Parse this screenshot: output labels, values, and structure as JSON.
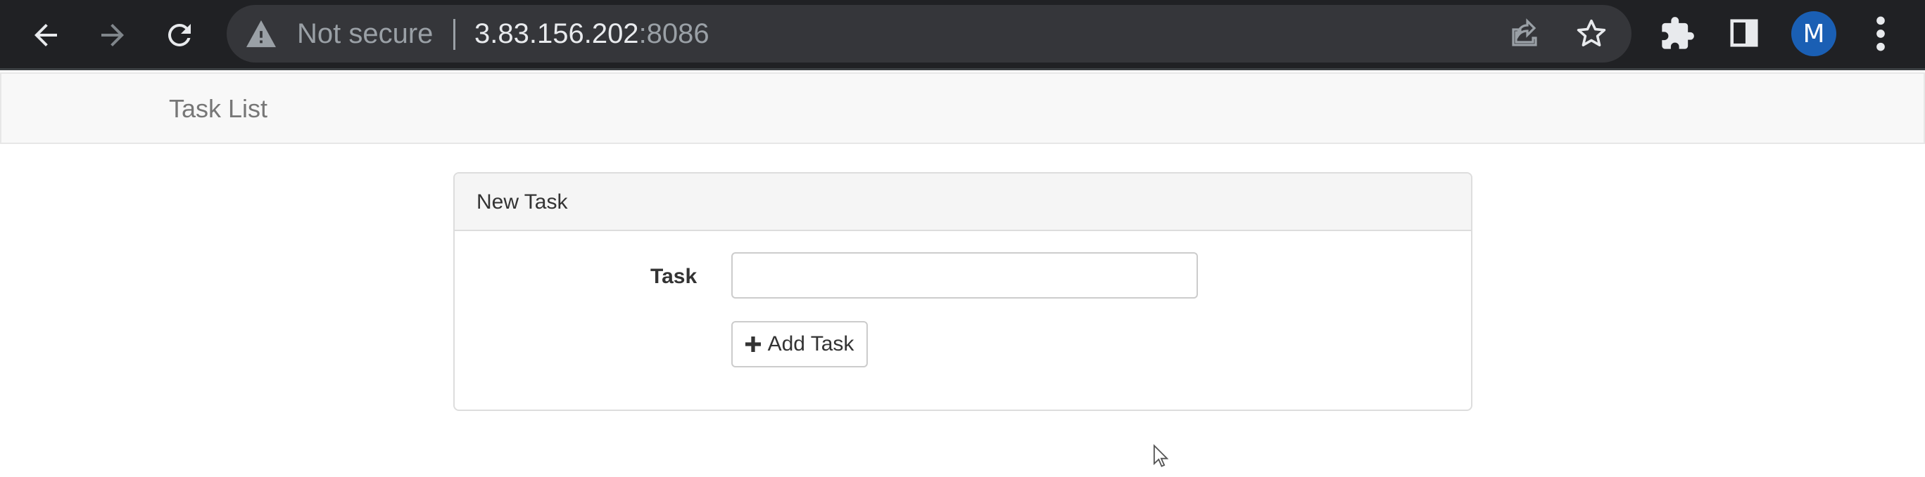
{
  "browser": {
    "security_text": "Not secure",
    "url_host": "3.83.156.202",
    "url_port": ":8086",
    "avatar_letter": "M",
    "icons": [
      "back-icon",
      "forward-icon",
      "reload-icon",
      "warning-icon",
      "share-icon",
      "star-icon",
      "extensions-icon",
      "side-panel-icon",
      "menu-icon"
    ],
    "colors": {
      "toolbar": "#202124",
      "omnibox": "#35363a",
      "avatar": "#1a5fb4"
    }
  },
  "navbar": {
    "brand": "Task List"
  },
  "panel": {
    "heading": "New Task",
    "task_label": "Task",
    "task_value": "",
    "add_button_label": "Add Task"
  }
}
